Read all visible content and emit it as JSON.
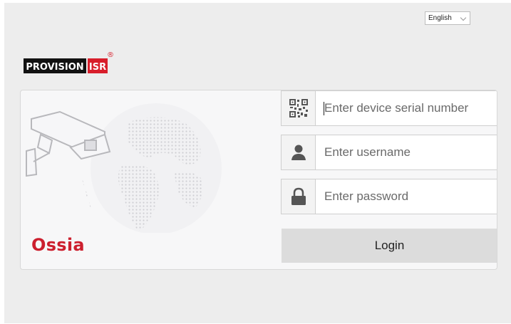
{
  "language_select": {
    "selected": "English"
  },
  "logo": {
    "text_left": "PROVISION",
    "text_right": "ISR",
    "registered": "®",
    "accent": "#d81e2b"
  },
  "brand": {
    "name": "Ossia",
    "color": "#cc1f2e"
  },
  "form": {
    "serial": {
      "placeholder": "Enter device serial number",
      "icon": "qr-code-icon"
    },
    "username": {
      "placeholder": "Enter username",
      "icon": "user-icon"
    },
    "password": {
      "placeholder": "Enter password",
      "icon": "lock-icon"
    },
    "login_label": "Login"
  }
}
